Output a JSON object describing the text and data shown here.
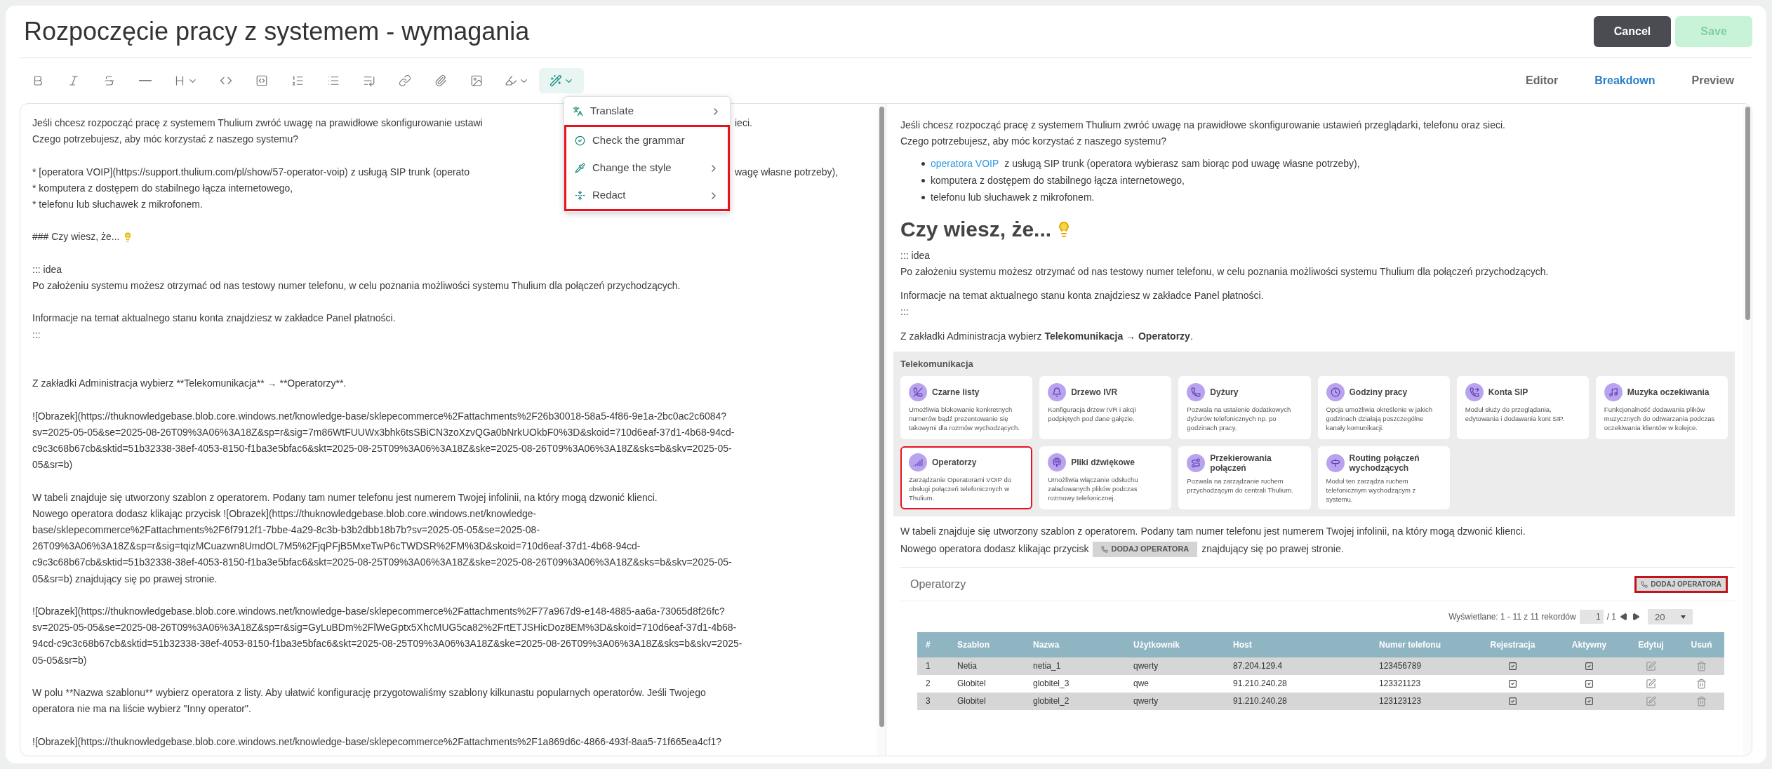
{
  "title": "Rozpoczęcie pracy z systemem - wymagania",
  "actions": [
    {
      "label": "Cancel",
      "kind": "secondary",
      "disabled": false
    },
    {
      "label": "Save",
      "kind": "primary",
      "disabled": true
    }
  ],
  "toolbar": [
    {
      "kind": "bold",
      "active": false
    },
    {
      "kind": "italic",
      "active": false
    },
    {
      "kind": "strike",
      "active": false
    },
    {
      "kind": "rule",
      "active": false
    },
    {
      "kind": "heading",
      "active": false
    },
    {
      "kind": "code",
      "active": false
    },
    {
      "kind": "codeblock",
      "active": false
    },
    {
      "kind": "ordered",
      "active": false
    },
    {
      "kind": "bullet",
      "active": false
    },
    {
      "kind": "indent",
      "active": false
    },
    {
      "kind": "link",
      "active": false
    },
    {
      "kind": "attach",
      "active": false
    },
    {
      "kind": "image",
      "active": false
    },
    {
      "kind": "highlight",
      "active": false
    },
    {
      "kind": "ai",
      "active": true
    }
  ],
  "ai_menu": [
    {
      "label": "Translate",
      "submenu": true,
      "highlighted": false
    },
    {
      "label": "Check the grammar",
      "submenu": false,
      "highlighted": true
    },
    {
      "label": "Change the style",
      "submenu": true,
      "highlighted": true
    },
    {
      "label": "Redact",
      "submenu": true,
      "highlighted": true
    }
  ],
  "view_tabs": [
    {
      "label": "Editor",
      "selected": false
    },
    {
      "label": "Breakdown",
      "selected": true
    },
    {
      "label": "Preview",
      "selected": false
    }
  ],
  "editor_lines": [
    {
      "kind": "covered",
      "text": "Jeśli chcesz rozpocząć pracę z systemem Thulium zwróć uwagę na prawidłowe skonfigurowanie ustawi",
      "rest": "ieci."
    },
    {
      "kind": "text",
      "text": "Czego potrzebujesz, aby móc korzystać z naszego systemu?"
    },
    {
      "kind": "blank"
    },
    {
      "kind": "covered",
      "text": "* [operatora VOIP](https://support.thulium.com/pl/show/57-operator-voip) z usługą SIP trunk (operato",
      "rest": "wagę własne potrzeby),"
    },
    {
      "kind": "text",
      "text": "* komputera z dostępem do stabilnego łącza internetowego,"
    },
    {
      "kind": "text",
      "text": "* telefonu lub słuchawek z mikrofonem."
    },
    {
      "kind": "blank"
    },
    {
      "kind": "bulb",
      "text": "### Czy wiesz, że..."
    },
    {
      "kind": "blank"
    },
    {
      "kind": "text",
      "text": "::: idea"
    },
    {
      "kind": "text",
      "text": "Po założeniu systemu możesz otrzymać od nas testowy numer telefonu, w celu poznania możliwości systemu Thulium dla połączeń przychodzących."
    },
    {
      "kind": "blank"
    },
    {
      "kind": "text",
      "text": "Informacje na temat aktualnego stanu konta znajdziesz w zakładce Panel płatności."
    },
    {
      "kind": "text",
      "text": ":::"
    },
    {
      "kind": "blank"
    },
    {
      "kind": "blank"
    },
    {
      "kind": "text",
      "text": "Z zakładki Administracja wybierz **Telekomunikacja** → **Operatorzy**."
    },
    {
      "kind": "blank"
    },
    {
      "kind": "text",
      "text": "![Obrazek](https://thuknowledgebase.blob.core.windows.net/knowledge-base/sklepecommerce%2Fattachments%2F26b30018-58a5-4f86-9e1a-2bc0ac2c6084?"
    },
    {
      "kind": "text",
      "text": "sv=2025-05-05&se=2025-08-26T09%3A06%3A18Z&sp=r&sig=7m86WtFUUWx3bhk6tsSBiCN3zoXzvQGa0bNrkUOkbF0%3D&skoid=710d6eaf-37d1-4b68-94cd-"
    },
    {
      "kind": "text",
      "text": "c9c3c68b67cb&sktid=51b32338-38ef-4053-8150-f1ba3e5bfac6&skt=2025-08-25T09%3A06%3A18Z&ske=2025-08-26T09%3A06%3A18Z&sks=b&skv=2025-05-"
    },
    {
      "kind": "text",
      "text": "05&sr=b)"
    },
    {
      "kind": "blank"
    },
    {
      "kind": "text",
      "text": "W tabeli znajduje się utworzony szablon z operatorem. Podany tam numer telefonu jest numerem Twojej infolinii, na który mogą dzwonić klienci."
    },
    {
      "kind": "text",
      "text": "Nowego operatora dodasz klikając przycisk ![Obrazek](https://thuknowledgebase.blob.core.windows.net/knowledge-"
    },
    {
      "kind": "text",
      "text": "base/sklepecommerce%2Fattachments%2F6f7912f1-7bbe-4a29-8c3b-b3b2dbb18b7b?sv=2025-05-05&se=2025-08-"
    },
    {
      "kind": "text",
      "text": "26T09%3A06%3A18Z&sp=r&sig=tqizMCuazwn8UmdOL7M5%2FjqPFjB5MxeTwP6cTWDSR%2FM%3D&skoid=710d6eaf-37d1-4b68-94cd-"
    },
    {
      "kind": "text",
      "text": "c9c3c68b67cb&sktid=51b32338-38ef-4053-8150-f1ba3e5bfac6&skt=2025-08-25T09%3A06%3A18Z&ske=2025-08-26T09%3A06%3A18Z&sks=b&skv=2025-05-"
    },
    {
      "kind": "text",
      "text": "05&sr=b) znajdujący się po prawej stronie."
    },
    {
      "kind": "blank"
    },
    {
      "kind": "text",
      "text": "![Obrazek](https://thuknowledgebase.blob.core.windows.net/knowledge-base/sklepecommerce%2Fattachments%2F77a967d9-e148-4885-aa6a-73065d8f26fc?"
    },
    {
      "kind": "text",
      "text": "sv=2025-05-05&se=2025-08-26T09%3A06%3A18Z&sp=r&sig=GyLuBDm%2FlWeGptx5XhcMUG5ca82%2FrtETJSHicDoz8EM%3D&skoid=710d6eaf-37d1-4b68-"
    },
    {
      "kind": "text",
      "text": "94cd-c9c3c68b67cb&sktid=51b32338-38ef-4053-8150-f1ba3e5bfac6&skt=2025-08-25T09%3A06%3A18Z&ske=2025-08-26T09%3A06%3A18Z&sks=b&skv=2025-"
    },
    {
      "kind": "text",
      "text": "05-05&sr=b)"
    },
    {
      "kind": "blank"
    },
    {
      "kind": "text",
      "text": "W polu **Nazwa szablonu** wybierz operatora z listy. Aby ułatwić konfigurację przygotowaliśmy szablony kilkunastu popularnych operatorów. Jeśli Twojego"
    },
    {
      "kind": "text",
      "text": "operatora nie ma na liście wybierz \"Inny operator\"."
    },
    {
      "kind": "blank"
    },
    {
      "kind": "text",
      "text": "![Obrazek](https://thuknowledgebase.blob.core.windows.net/knowledge-base/sklepecommerce%2Fattachments%2F1a869d6c-4866-493f-8aa5-71f665ea4cf1?"
    }
  ],
  "preview": {
    "intro": [
      "Jeśli chcesz rozpocząć pracę z systemem Thulium zwróć uwagę na prawidłowe skonfigurowanie ustawień przeglądarki, telefonu oraz sieci.",
      "Czego potrzebujesz, aby móc korzystać z naszego systemu?"
    ],
    "list": [
      {
        "link": "operatora VOIP",
        "text": "z usługą SIP trunk (operatora wybierasz sam biorąc pod uwagę własne potrzeby),"
      },
      {
        "text": "komputera z dostępem do stabilnego łącza internetowego,"
      },
      {
        "text": "telefonu lub słuchawek z mikrofonem."
      }
    ],
    "heading": "Czy wiesz, że...",
    "idea_open": "::: idea",
    "idea_text": "Po założeniu systemu możesz otrzymać od nas testowy numer telefonu, w celu poznania możliwości systemu Thulium dla połączeń przychodzących.",
    "info": "Informacje na temat aktualnego stanu konta znajdziesz w zakładce Panel płatności.",
    "idea_close": ":::",
    "navigation": "Z zakładki Administracja wybierz **Telekomunikacja → Operatorzy**.",
    "telecom_screenshot": {
      "title": "Telekomunikacja",
      "tiles": [
        {
          "title": "Czarne listy",
          "description": "Umożliwia blokowanie konkretnych numerów bądź prezentowanie się takowymi dla rozmów wychodzących.",
          "highlighted": false
        },
        {
          "title": "Drzewo IVR",
          "description": "Konfiguracja drzew IVR i akcji podpiętych pod dane gałęzie.",
          "highlighted": false
        },
        {
          "title": "Dyżury",
          "description": "Pozwala na ustalenie dodatkowych dyżurów telefonicznych np. po godzinach pracy.",
          "highlighted": false
        },
        {
          "title": "Godziny pracy",
          "description": "Opcja umożliwia określenie w jakich godzinach działają poszczególne kanały komunikacji.",
          "highlighted": false
        },
        {
          "title": "Konta SIP",
          "description": "Moduł służy do przeglądania, edytowania i dodawania kont SIP.",
          "highlighted": false
        },
        {
          "title": "Muzyka oczekiwania",
          "description": "Funkcjonalność dodawania plików muzycznych do odtwarzania podczas oczekiwania klientów w kolejce.",
          "highlighted": false
        },
        {
          "title": "Operatorzy",
          "description": "Zarządzanie Operatorami VOIP do obsługi połączeń telefonicznych w Thulium.",
          "highlighted": true
        },
        {
          "title": "Pliki dźwiękowe",
          "description": "Umożliwia włączanie odsłuchu załadowanych plików podczas rozmowy telefonicznej.",
          "highlighted": false
        },
        {
          "title": "Przekierowania połączeń",
          "description": "Pozwala na zarządzanie ruchem przychodzącym do centrali Thulium.",
          "highlighted": false
        },
        {
          "title": "Routing połączeń wychodzących",
          "description": "Moduł ten zarządza ruchem telefonicznym wychodzącym z systemu.",
          "highlighted": false
        }
      ]
    },
    "table_note": "W tabeli znajduje się utworzony szablon z operatorem. Podany tam numer telefonu jest numerem Twojej infolinii, na który mogą dzwonić klienci.",
    "add_note": {
      "before": "Nowego operatora dodasz klikając przycisk",
      "button": "DODAJ OPERATORA",
      "after": "znajdujący się po prawej stronie."
    },
    "operators_screenshot": {
      "title": "Operatorzy",
      "add_button": {
        "label": "DODAJ OPERATORA",
        "highlighted": true
      },
      "records": "Wyświetlane: 1 - 11 z 11 rekordów",
      "page": "1",
      "pages": "/ 1",
      "page_size": "20",
      "columns": [
        "#",
        "Szablon",
        "Nazwa",
        "Użytkownik",
        "Host",
        "Numer telefonu",
        "Rejestracja",
        "Aktywny",
        "Edytuj",
        "Usuń"
      ],
      "rows": [
        {
          "number": "1",
          "template": "Netia",
          "name": "netia_1",
          "user": "qwerty",
          "host": "87.204.129.4",
          "phone": "123456789",
          "registration": true,
          "active": true
        },
        {
          "number": "2",
          "template": "Globitel",
          "name": "globitel_3",
          "user": "qwe",
          "host": "91.210.240.28",
          "phone": "123321123",
          "registration": true,
          "active": true
        },
        {
          "number": "3",
          "template": "Globitel",
          "name": "globitel_2",
          "user": "qwerty",
          "host": "91.210.240.28",
          "phone": "123123123",
          "registration": true,
          "active": true
        }
      ]
    }
  }
}
